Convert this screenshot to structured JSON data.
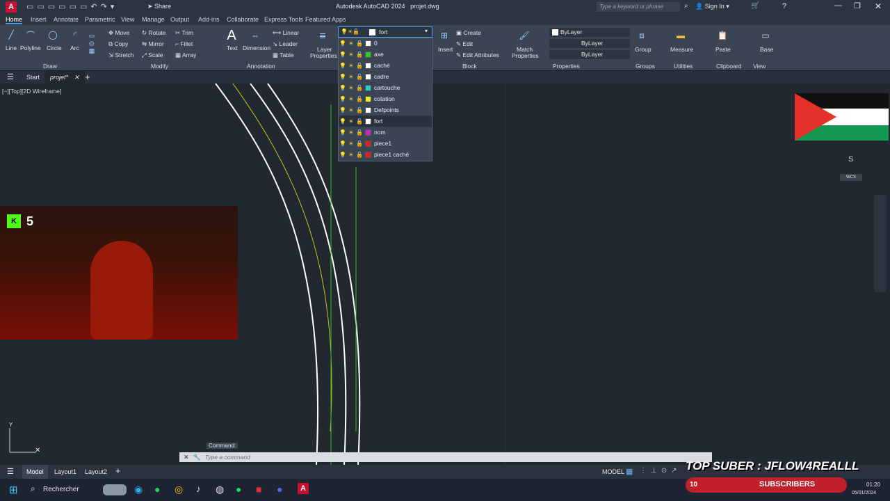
{
  "window": {
    "title": "Autodesk AutoCAD 2024",
    "file": "projet.dwg",
    "search_placeholder": "Type a keyword or phrase",
    "sign_in": "Sign In",
    "share": "Share"
  },
  "ribbon_tabs": [
    "Home",
    "Insert",
    "Annotate",
    "Parametric",
    "View",
    "Manage",
    "Output",
    "Add-ins",
    "Collaborate",
    "Express Tools",
    "Featured Apps"
  ],
  "draw": {
    "line": "Line",
    "polyline": "Polyline",
    "circle": "Circle",
    "arc": "Arc",
    "panel": "Draw"
  },
  "modify": {
    "move": "Move",
    "rotate": "Rotate",
    "trim": "Trim",
    "copy": "Copy",
    "mirror": "Mirror",
    "fillet": "Fillet",
    "stretch": "Stretch",
    "scale": "Scale",
    "array": "Array",
    "panel": "Modify"
  },
  "annotation": {
    "text": "Text",
    "dimension": "Dimension",
    "linear": "Linear",
    "leader": "Leader",
    "table": "Table",
    "panel": "Annotation"
  },
  "layers": {
    "layer_properties_1": "Layer",
    "layer_properties_2": "Properties",
    "current": "fort"
  },
  "block": {
    "insert": "Insert",
    "create": "Create",
    "edit": "Edit",
    "edit_attributes": "Edit Attributes",
    "panel": "Block"
  },
  "properties": {
    "match_1": "Match",
    "match_2": "Properties",
    "color": "ByLayer",
    "linetype": "ByLayer",
    "lineweight": "ByLayer",
    "panel": "Properties"
  },
  "groups": {
    "group": "Group",
    "panel": "Groups"
  },
  "utilities": {
    "measure": "Measure",
    "panel": "Utilities"
  },
  "clipboard": {
    "paste": "Paste",
    "panel": "Clipboard"
  },
  "view": {
    "base": "Base",
    "panel": "View"
  },
  "layer_list": [
    {
      "name": "0",
      "color": "#ffffff"
    },
    {
      "name": "axe",
      "color": "#22cc22"
    },
    {
      "name": "caché",
      "color": "#ffffff"
    },
    {
      "name": "cadre",
      "color": "#ffffff"
    },
    {
      "name": "cartouche",
      "color": "#22cccc"
    },
    {
      "name": "cotation",
      "color": "#eeee22"
    },
    {
      "name": "Defpoints",
      "color": "#ffffff"
    },
    {
      "name": "fort",
      "color": "#ffffff"
    },
    {
      "name": "nom",
      "color": "#cc22cc"
    },
    {
      "name": "piece1",
      "color": "#dd2222"
    },
    {
      "name": "piece1 caché",
      "color": "#dd2222"
    }
  ],
  "file_tabs": {
    "start": "Start",
    "project": "projet*"
  },
  "viewport_label": "[−][Top][2D Wireframe]",
  "viewcube": {
    "south": "S",
    "wcs": "WCS"
  },
  "overlay": {
    "kick_count": "5",
    "banner": "TOP SUBER : JFLOW4REALLL",
    "subs_count": "10",
    "subs_label": "SUBSCRIBERS"
  },
  "command": {
    "label": "Command:",
    "placeholder": "Type a command"
  },
  "layout_tabs": [
    "Model",
    "Layout1",
    "Layout2"
  ],
  "status": {
    "model": "MODEL"
  },
  "taskbar": {
    "search": "Rechercher",
    "time": "01:20",
    "date": "05/01/2024"
  }
}
